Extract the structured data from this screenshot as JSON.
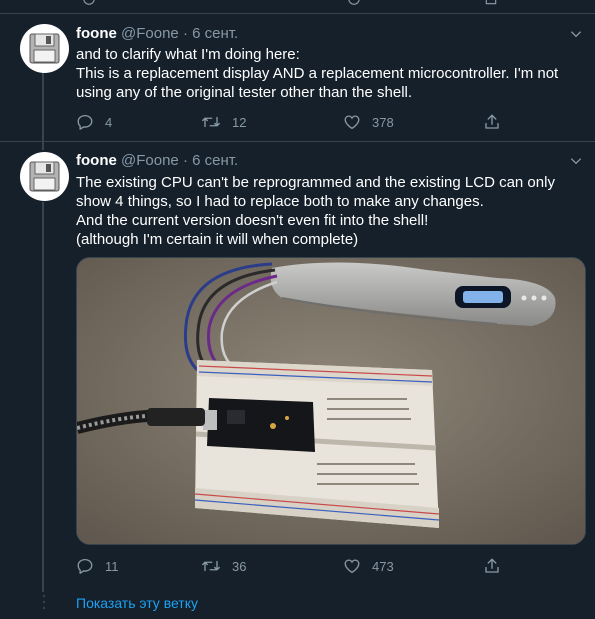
{
  "colors": {
    "background": "#15202b",
    "accent": "#1da1f2",
    "muted": "#8899a6",
    "text": "#ffffff",
    "border": "#38444d"
  },
  "tweets": [
    {
      "name": "foone",
      "handle": "@Foone",
      "dot": "·",
      "date": "6 сент.",
      "lines": [
        "and to clarify what I'm doing here:",
        "This is a replacement display AND a replacement microcontroller. I'm not",
        "using any of the original tester other than the shell."
      ],
      "replies": "4",
      "retweets": "12",
      "likes": "378"
    },
    {
      "name": "foone",
      "handle": "@Foone",
      "dot": "·",
      "date": "6 сент.",
      "lines": [
        "The existing CPU can't be reprogrammed and the existing LCD can only",
        "show 4 things, so I had to replace both to make any changes.",
        "And the current version doesn't even fit into the shell!",
        "(although I'm certain it will when complete)"
      ],
      "replies": "11",
      "retweets": "36",
      "likes": "473"
    }
  ],
  "show_thread": "Показать эту ветку",
  "icons": [
    "reply-icon",
    "retweet-icon",
    "like-icon",
    "share-icon",
    "chevron-down-icon",
    "floppy-disk-icon"
  ]
}
